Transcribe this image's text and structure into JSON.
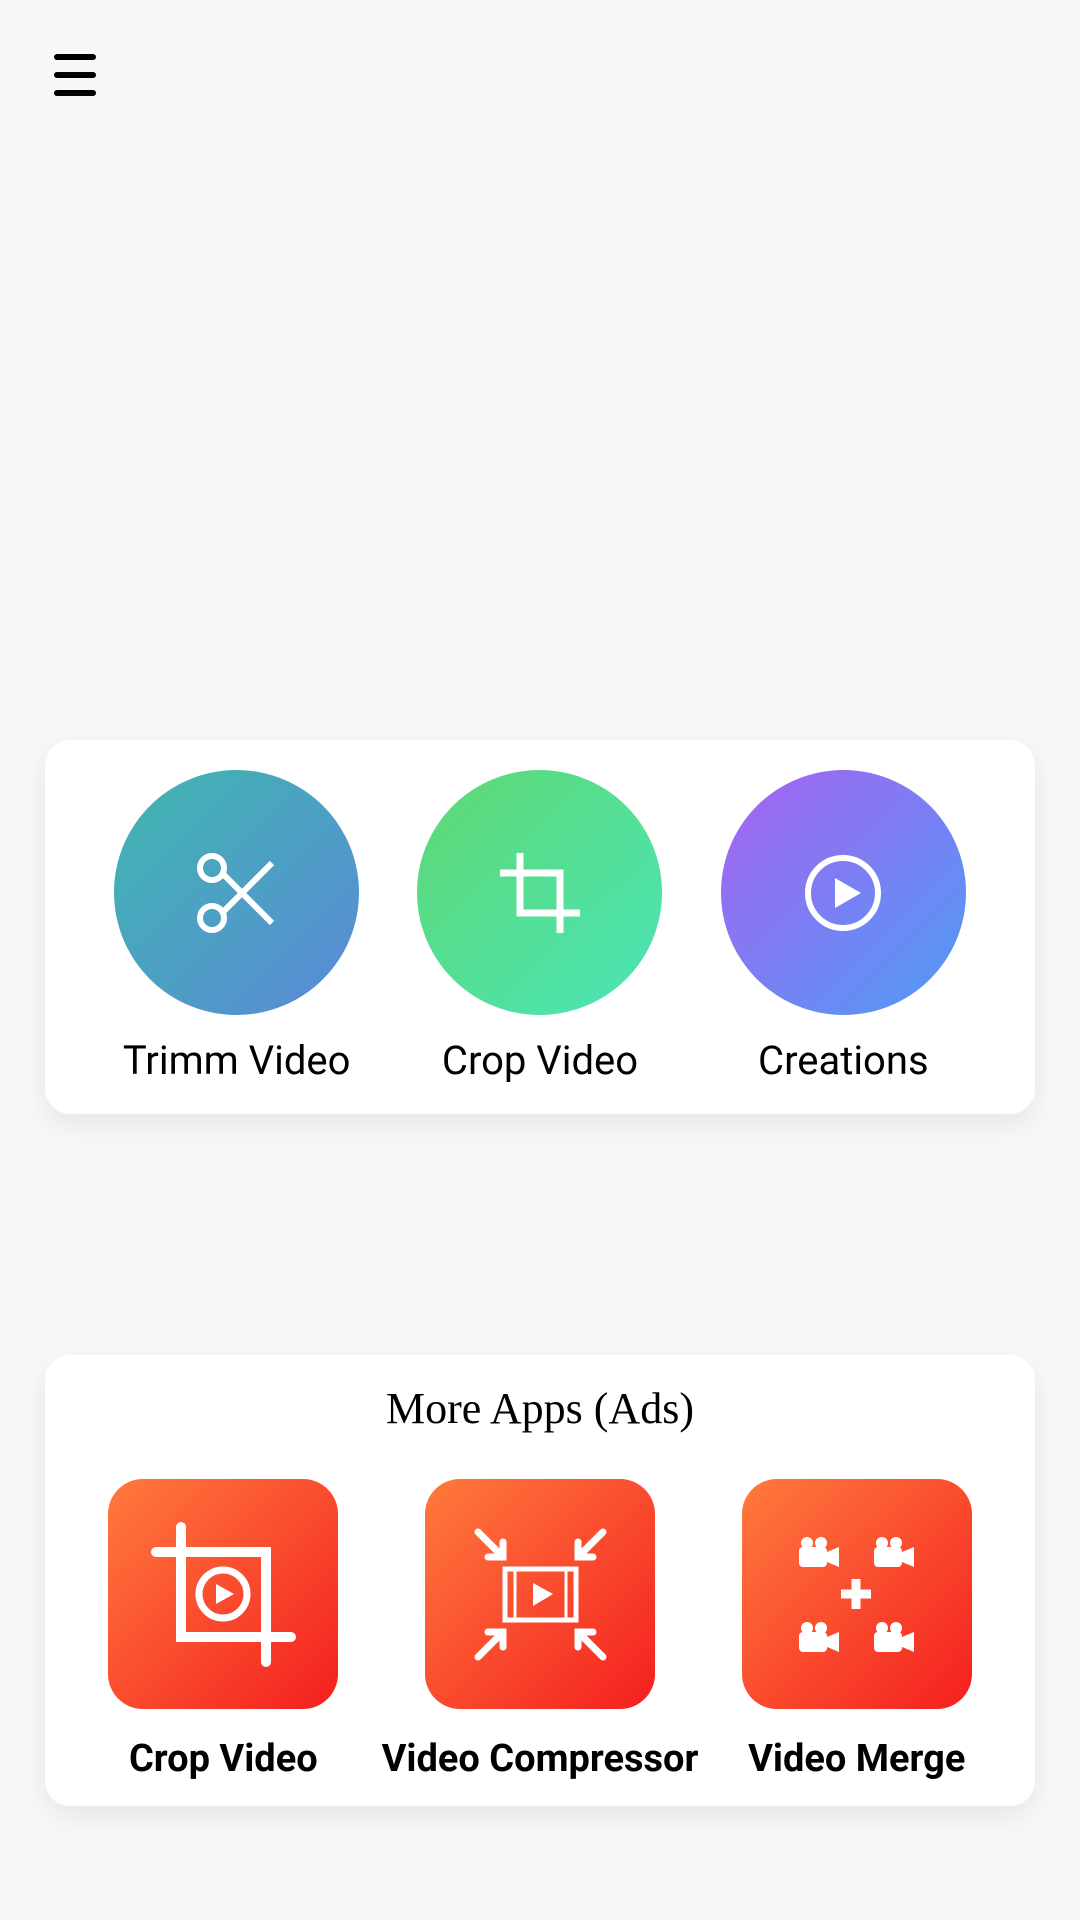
{
  "mainActions": {
    "trim": {
      "label": "Trimm Video"
    },
    "crop": {
      "label": "Crop Video"
    },
    "creations": {
      "label": "Creations"
    }
  },
  "adsSection": {
    "title": "More Apps (Ads)",
    "items": {
      "cropVideo": {
        "label": "Crop Video"
      },
      "compressor": {
        "label": "Video Compressor"
      },
      "merge": {
        "label": "Video Merge"
      }
    }
  }
}
